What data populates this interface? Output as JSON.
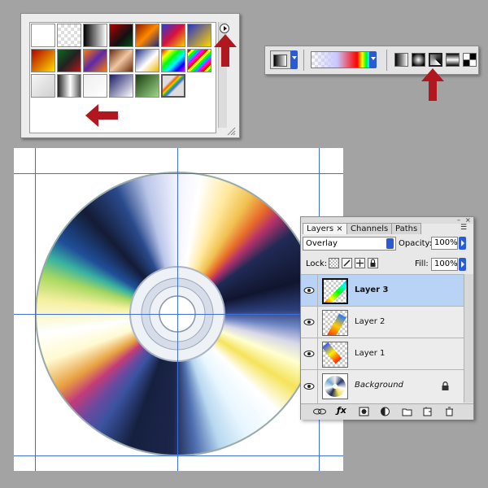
{
  "picker": {
    "swatches": [
      "linear-gradient(135deg,#ffffff,#ffffff)",
      "repeating-conic-gradient(#ddd 0 25%,#fff 0 50%) 0 0/8px 8px",
      "linear-gradient(90deg,#000,#fff)",
      "linear-gradient(135deg,#b30000,#111 60%,#0a4d1e)",
      "linear-gradient(135deg,#8a1a00,#ff8800,#1b2a7a)",
      "linear-gradient(135deg,#2b3bd6,#d8103d,#f0d000)",
      "linear-gradient(135deg,#2533c8,#ffd400)",
      "linear-gradient(135deg,#b20000,#ffdd00)",
      "linear-gradient(135deg,#0a6b1e,#222 50%,#b21a1a)",
      "linear-gradient(135deg,#ff7a00,#5d2aa8,#ff7a00)",
      "linear-gradient(135deg,#6b2a0b,#f0c6a0,#6b2a0b)",
      "linear-gradient(135deg,#1c2d8c,#ffffff 55%,#f0b600)",
      "linear-gradient(135deg,#ff0000,#ffff00,#00ff00,#00ffff,#0000ff,#ff00ff)",
      "repeating-linear-gradient(135deg,#ff0000 0 3px,#ffff00 3px 6px,#00ff00 6px 9px,#00aaff 9px 12px,#ff00ff 12px 15px)",
      "linear-gradient(135deg,#f5f5f5,#cfcfcf)",
      "linear-gradient(90deg,#222,#fff 55%,#555)",
      "linear-gradient(135deg,#eeeeee,#ffffff)",
      "linear-gradient(135deg,#1c1c6a,#ffffff)",
      "linear-gradient(135deg,#1a3d0f,#9fd68a)",
      "linear-gradient(135deg,#ddd 0 30%,#ff5a00 38%,#ffd000 44%,#3ab54a 50%,#3a6ee0 56%,#ddd 64%)"
    ]
  },
  "options_bar": {
    "gradient_preview": "linear-gradient(90deg,transparent 0%,#c8c8ff 40%,#ff0000 72%,#ffff00 80%,#00ff00 86%,#00ffff 90%,#0000ff 95%,#ff00ff 100%)"
  },
  "layers": {
    "tabs": [
      "Layers",
      "Channels",
      "Paths"
    ],
    "blend_mode": "Overlay",
    "opacity_label": "Opacity:",
    "opacity": "100%",
    "lock_label": "Lock:",
    "fill_label": "Fill:",
    "fill": "100%",
    "rows": [
      {
        "name": "Layer 3",
        "selected": true
      },
      {
        "name": "Layer 2",
        "selected": false
      },
      {
        "name": "Layer 1",
        "selected": false
      },
      {
        "name": "Background",
        "selected": false,
        "locked": true
      }
    ]
  },
  "colors": {
    "arrow_red": "#b0171e",
    "guide_blue": "#3f6fd8",
    "selection_blue": "#b8d3f5",
    "dropdown_blue": "#2a5bd7"
  }
}
